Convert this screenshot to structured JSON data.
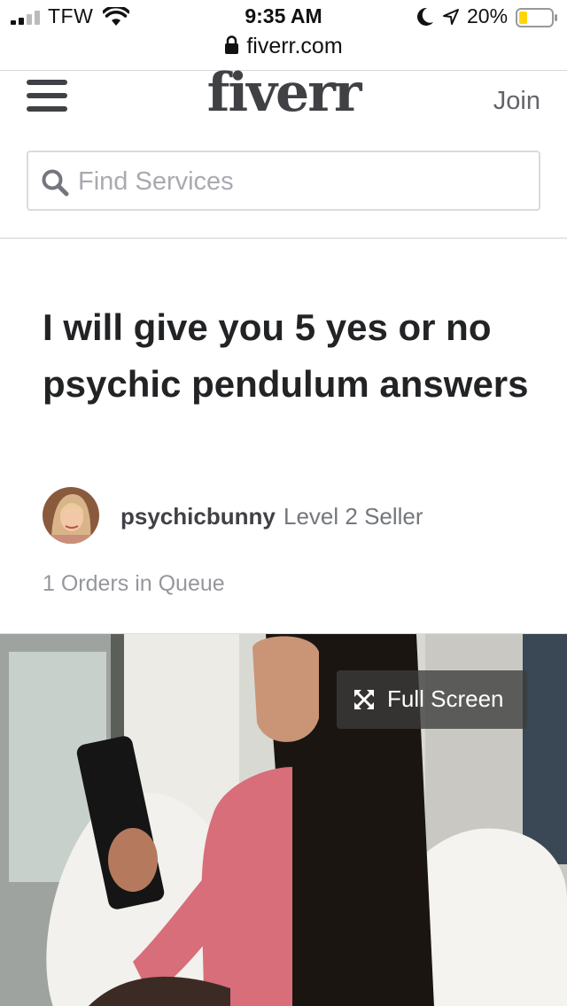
{
  "status_bar": {
    "carrier": "TFW",
    "time": "9:35 AM",
    "battery": "20%"
  },
  "browser": {
    "url": "fiverr.com"
  },
  "header": {
    "logo": "fiverr",
    "join_label": "Join"
  },
  "search": {
    "placeholder": "Find Services"
  },
  "gig": {
    "title": "I will give you 5 yes or no psychic pendulum answers",
    "seller_name": "psychicbunny",
    "seller_level": "Level 2 Seller",
    "orders_in_queue": "1 Orders in Queue"
  },
  "media": {
    "fullscreen_label": "Full Screen"
  },
  "colors": {
    "text_dark": "#222325",
    "text_muted": "#95979d",
    "logo": "#404145",
    "border": "#dadbdd",
    "battery_low": "#ffd60a"
  },
  "icons": [
    "signal-icon",
    "wifi-icon",
    "moon-icon",
    "location-icon",
    "battery-icon",
    "lock-icon",
    "menu-icon",
    "search-icon",
    "expand-icon"
  ]
}
